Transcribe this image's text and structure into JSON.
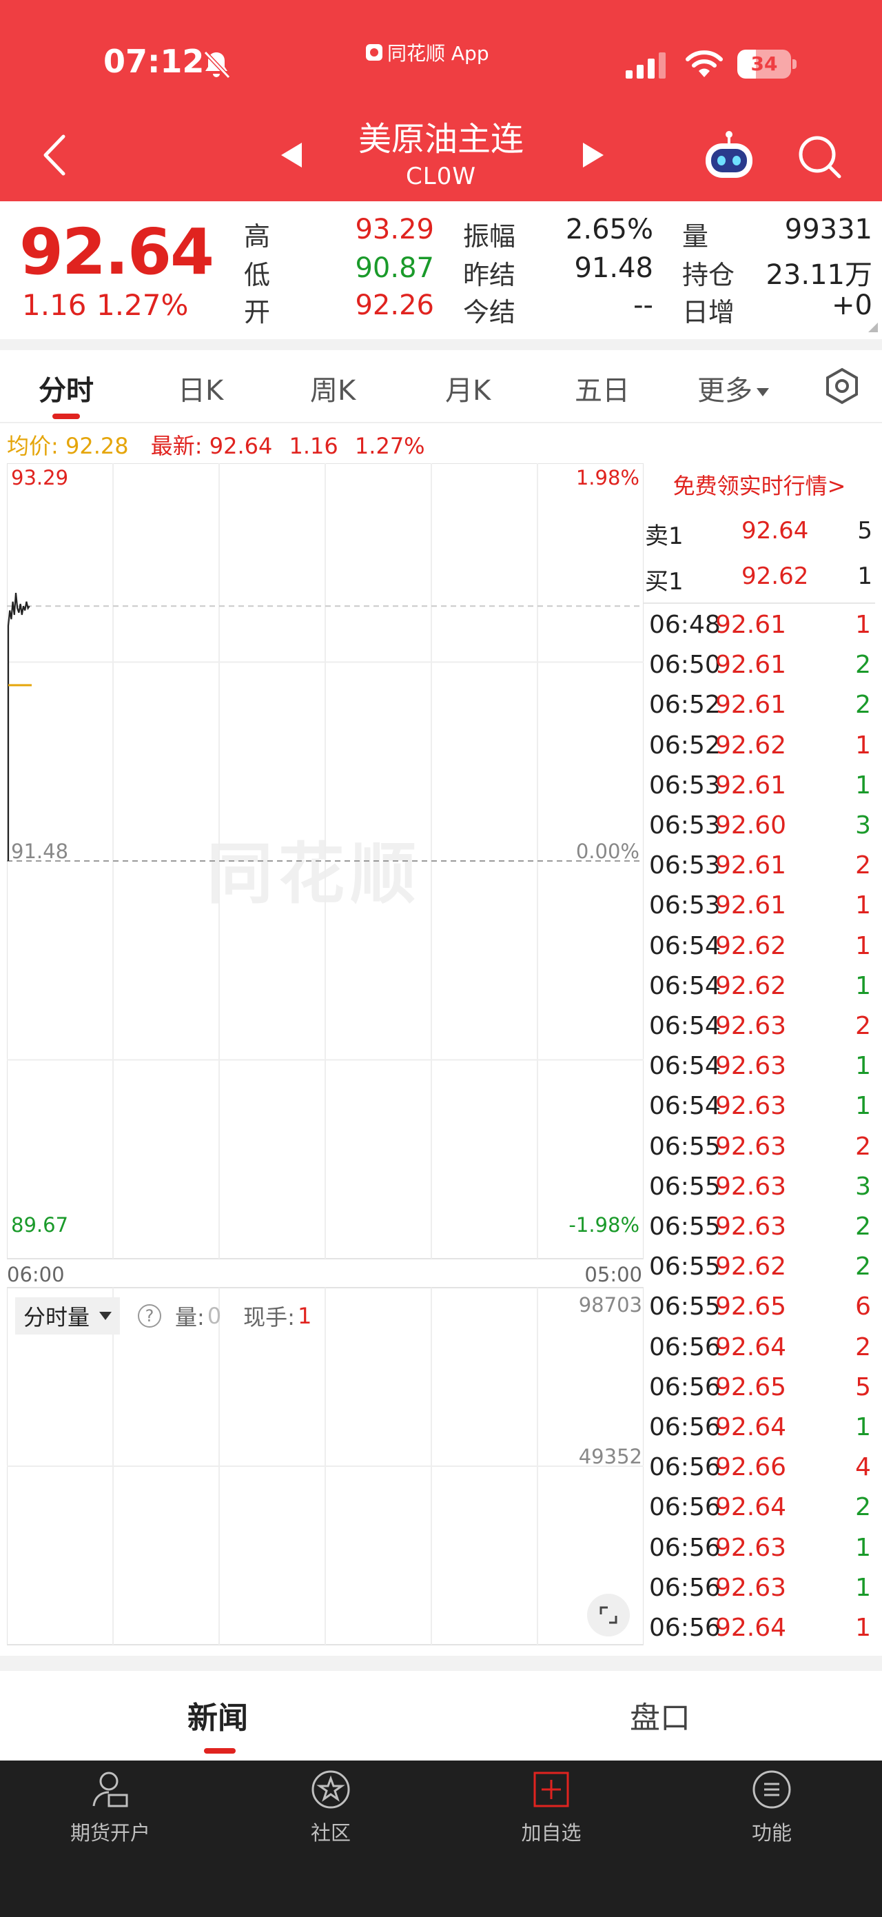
{
  "status_bar": {
    "time": "07:12",
    "app_label": "同花顺 App",
    "battery": "34",
    "battery_level": 0.34,
    "icons": [
      "bell-muted-icon",
      "signal-icon",
      "wifi-icon",
      "battery-icon"
    ]
  },
  "nav": {
    "title": "美原油主连",
    "code": "CL0W",
    "icons": [
      "back-icon",
      "prev-icon",
      "next-icon",
      "robot-icon",
      "search-icon"
    ]
  },
  "quote": {
    "price": "92.64",
    "change": "1.16",
    "change_pct": "1.27%",
    "rows": [
      [
        {
          "label": "高",
          "value": "93.29",
          "color": "red"
        },
        {
          "label": "振幅",
          "value": "2.65%",
          "color": "dark"
        },
        {
          "label": "量",
          "value": "99331",
          "color": "dark"
        }
      ],
      [
        {
          "label": "低",
          "value": "90.87",
          "color": "green"
        },
        {
          "label": "昨结",
          "value": "91.48",
          "color": "dark"
        },
        {
          "label": "持仓",
          "value": "23.11万",
          "color": "dark"
        }
      ],
      [
        {
          "label": "开",
          "value": "92.26",
          "color": "red"
        },
        {
          "label": "今结",
          "value": "--",
          "color": "dark"
        },
        {
          "label": "日增",
          "value": "+0",
          "color": "dark"
        }
      ]
    ]
  },
  "tabs": [
    "分时",
    "日K",
    "周K",
    "月K",
    "五日",
    "更多"
  ],
  "active_tab": "分时",
  "summary": {
    "avg_label": "均价:",
    "avg_value": "92.28",
    "last_label": "最新:",
    "last_value": "92.64",
    "last_change": "1.16",
    "last_pct": "1.27%"
  },
  "chart": {
    "y_top": "93.29",
    "y_mid": "91.48",
    "y_bot": "89.67",
    "pct_top": "1.98%",
    "pct_mid": "0.00%",
    "pct_bot": "-1.98%",
    "x_start": "06:00",
    "x_end": "05:00",
    "watermark": "同花顺",
    "vol_top": "98703",
    "vol_mid": "49352",
    "vol_select": "分时量",
    "vol_label": "量:",
    "vol_value": "0",
    "hand_label": "现手:",
    "hand_value": "1"
  },
  "chart_data": {
    "type": "line",
    "title": "",
    "xlabel": "",
    "ylabel": "",
    "x_range": [
      "06:00",
      "05:00"
    ],
    "ylim": [
      89.67,
      93.29
    ],
    "reference": 91.48,
    "series": [
      {
        "values": [
          92.55,
          92.62,
          92.58,
          92.66,
          92.6,
          92.7,
          92.63,
          92.61,
          92.65,
          92.6,
          92.64,
          92.62,
          92.66,
          92.63,
          92.64
        ]
      },
      {
        "values": [
          92.28,
          92.28
        ]
      }
    ],
    "volume_ylim": [
      0,
      98703
    ]
  },
  "order_book": {
    "promo": "免费领实时行情>",
    "sell": {
      "label": "卖1",
      "price": "92.64",
      "vol": "5"
    },
    "buy": {
      "label": "买1",
      "price": "92.62",
      "vol": "1"
    }
  },
  "ticks": [
    {
      "t": "06:48",
      "p": "92.61",
      "v": "1",
      "c": "red"
    },
    {
      "t": "06:50",
      "p": "92.61",
      "v": "2",
      "c": "green"
    },
    {
      "t": "06:52",
      "p": "92.61",
      "v": "2",
      "c": "green"
    },
    {
      "t": "06:52",
      "p": "92.62",
      "v": "1",
      "c": "red"
    },
    {
      "t": "06:53",
      "p": "92.61",
      "v": "1",
      "c": "green"
    },
    {
      "t": "06:53",
      "p": "92.60",
      "v": "3",
      "c": "green"
    },
    {
      "t": "06:53",
      "p": "92.61",
      "v": "2",
      "c": "red"
    },
    {
      "t": "06:53",
      "p": "92.61",
      "v": "1",
      "c": "red"
    },
    {
      "t": "06:54",
      "p": "92.62",
      "v": "1",
      "c": "red"
    },
    {
      "t": "06:54",
      "p": "92.62",
      "v": "1",
      "c": "green"
    },
    {
      "t": "06:54",
      "p": "92.63",
      "v": "2",
      "c": "red"
    },
    {
      "t": "06:54",
      "p": "92.63",
      "v": "1",
      "c": "green"
    },
    {
      "t": "06:54",
      "p": "92.63",
      "v": "1",
      "c": "green"
    },
    {
      "t": "06:55",
      "p": "92.63",
      "v": "2",
      "c": "red"
    },
    {
      "t": "06:55",
      "p": "92.63",
      "v": "3",
      "c": "green"
    },
    {
      "t": "06:55",
      "p": "92.63",
      "v": "2",
      "c": "green"
    },
    {
      "t": "06:55",
      "p": "92.62",
      "v": "2",
      "c": "green"
    },
    {
      "t": "06:55",
      "p": "92.65",
      "v": "6",
      "c": "red"
    },
    {
      "t": "06:56",
      "p": "92.64",
      "v": "2",
      "c": "red"
    },
    {
      "t": "06:56",
      "p": "92.65",
      "v": "5",
      "c": "red"
    },
    {
      "t": "06:56",
      "p": "92.64",
      "v": "1",
      "c": "green"
    },
    {
      "t": "06:56",
      "p": "92.66",
      "v": "4",
      "c": "red"
    },
    {
      "t": "06:56",
      "p": "92.64",
      "v": "2",
      "c": "green"
    },
    {
      "t": "06:56",
      "p": "92.63",
      "v": "1",
      "c": "green"
    },
    {
      "t": "06:56",
      "p": "92.63",
      "v": "1",
      "c": "green"
    },
    {
      "t": "06:56",
      "p": "92.64",
      "v": "1",
      "c": "red"
    }
  ],
  "news_tabs": [
    "新闻",
    "盘口"
  ],
  "bottom_nav": [
    {
      "label": "期货开户",
      "icon": "account-icon"
    },
    {
      "label": "社区",
      "icon": "community-icon"
    },
    {
      "label": "加自选",
      "icon": "add-watchlist-icon"
    },
    {
      "label": "功能",
      "icon": "menu-icon"
    }
  ],
  "colors": {
    "brand": "#ef3e42",
    "up": "#e0231f",
    "down": "#1a9a2a",
    "avg": "#e5a50a",
    "bottom_bar": "#1f1f1f"
  }
}
